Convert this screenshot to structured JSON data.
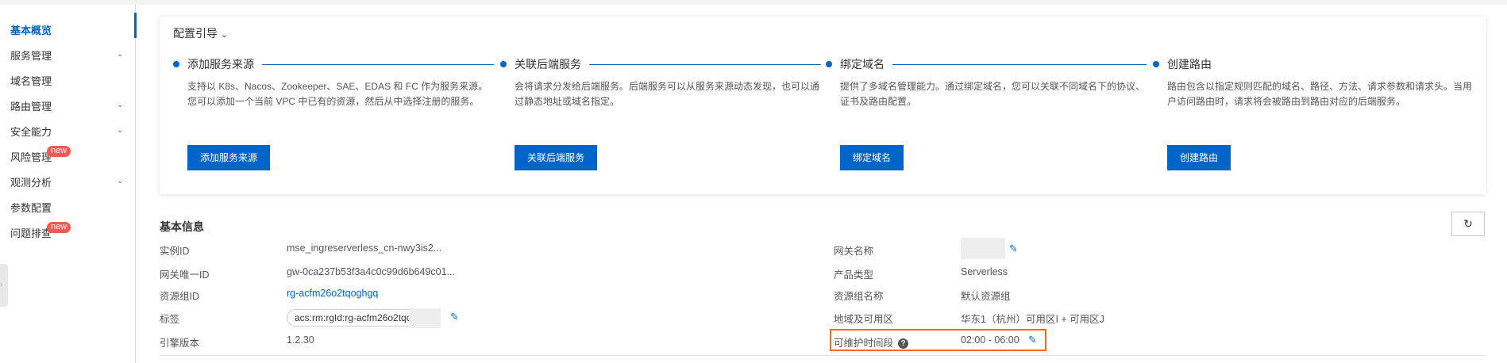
{
  "sidebar": {
    "items": [
      {
        "label": "基本概览",
        "active": true
      },
      {
        "label": "服务管理",
        "expandable": true
      },
      {
        "label": "域名管理"
      },
      {
        "label": "路由管理",
        "expandable": true
      },
      {
        "label": "安全能力",
        "expandable": true
      },
      {
        "label": "风险管理",
        "badge": "new"
      },
      {
        "label": "观测分析",
        "expandable": true
      },
      {
        "label": "参数配置"
      },
      {
        "label": "问题排查",
        "badge": "new"
      }
    ]
  },
  "guide": {
    "title": "配置引导",
    "steps": [
      {
        "name": "添加服务来源",
        "desc": "支持以 K8s、Nacos、Zookeeper、SAE、EDAS 和 FC 作为服务来源。您可以添加一个当前 VPC 中已有的资源，然后从中选择注册的服务。",
        "button": "添加服务来源"
      },
      {
        "name": "关联后端服务",
        "desc": "会将请求分发给后端服务。后端服务可以从服务来源动态发现，也可以通过静态地址或域名指定。",
        "button": "关联后端服务"
      },
      {
        "name": "绑定域名",
        "desc": "提供了多域名管理能力。通过绑定域名，您可以关联不同域名下的协议、证书及路由配置。",
        "button": "绑定域名"
      },
      {
        "name": "创建路由",
        "desc": "路由包含以指定规则匹配的域名、路径、方法、请求参数和请求头。当用户访问路由时，请求将会被路由到路由对应的后端服务。",
        "button": "创建路由"
      }
    ]
  },
  "basic_info": {
    "title": "基本信息",
    "left": [
      {
        "label": "实例ID",
        "value": "mse_ingreserverless_cn-nwy3is2..."
      },
      {
        "label": "网关唯一ID",
        "value": "gw-0ca237b53f3a4c0c99d6b649c01..."
      },
      {
        "label": "资源组ID",
        "value": "rg-acfm26o2tqoghgq"
      },
      {
        "label": "标签",
        "value": "acs:rm:rgId:rg-acfm26o2tqo"
      },
      {
        "label": "引擎版本",
        "value": "1.2.30"
      }
    ],
    "right": [
      {
        "label": "网关名称",
        "value": ""
      },
      {
        "label": "产品类型",
        "value": "Serverless"
      },
      {
        "label": "资源组名称",
        "value": "默认资源组"
      },
      {
        "label": "地域及可用区",
        "value": "华东1（杭州）可用区I + 可用区J"
      },
      {
        "label": "可维护时间段",
        "value": "02:00 - 06:00"
      }
    ]
  },
  "colors": {
    "accent": "#0064c8",
    "highlight": "#f76b0f",
    "badge": "#f05a4f"
  }
}
